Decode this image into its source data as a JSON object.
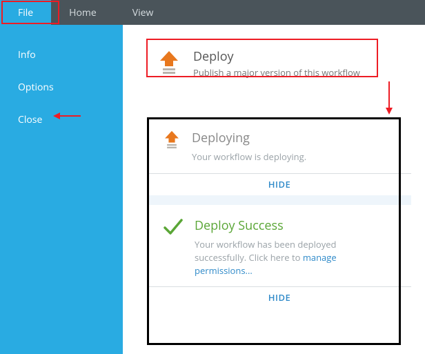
{
  "topbar": {
    "tabs": [
      {
        "label": "File",
        "active": true
      },
      {
        "label": "Home",
        "active": false
      },
      {
        "label": "View",
        "active": false
      }
    ]
  },
  "sidebar": {
    "items": [
      {
        "label": "Info"
      },
      {
        "label": "Options"
      },
      {
        "label": "Close"
      }
    ]
  },
  "deploy": {
    "title": "Deploy",
    "subtitle": "Publish a major version of this workflow"
  },
  "status": {
    "deploying": {
      "title": "Deploying",
      "body": "Your workflow is deploying.",
      "hide": "HIDE"
    },
    "success": {
      "title": "Deploy Success",
      "body_prefix": "Your workflow has been deployed successfully. Click here to ",
      "body_link": "manage permissions...",
      "hide": "HIDE"
    }
  },
  "colors": {
    "accent": "#29abe2",
    "brand_orange": "#e8781e",
    "success_green": "#5aa636",
    "annotation_red": "#ed1c24"
  }
}
